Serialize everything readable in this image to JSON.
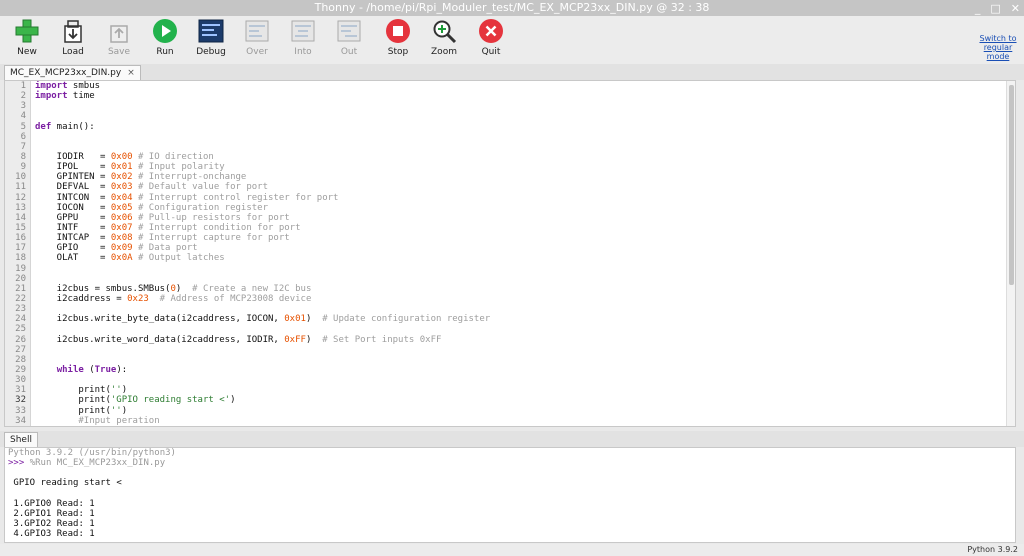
{
  "window": {
    "title": "Thonny  -  /home/pi/Rpi_Moduler_test/MC_EX_MCP23xx_DIN.py  @  32 : 38",
    "controls": [
      "_",
      "□",
      "✕"
    ]
  },
  "toolbar": {
    "buttons": [
      {
        "label": "New",
        "icon": "plus-icon",
        "enabled": true
      },
      {
        "label": "Load",
        "icon": "load-icon",
        "enabled": true
      },
      {
        "label": "Save",
        "icon": "save-icon",
        "enabled": false
      },
      {
        "label": "Run",
        "icon": "run-icon",
        "enabled": true
      },
      {
        "label": "Debug",
        "icon": "debug-icon",
        "enabled": true
      },
      {
        "label": "Over",
        "icon": "step-over-icon",
        "enabled": false
      },
      {
        "label": "Into",
        "icon": "step-into-icon",
        "enabled": false
      },
      {
        "label": "Out",
        "icon": "step-out-icon",
        "enabled": false
      },
      {
        "label": "Stop",
        "icon": "stop-icon",
        "enabled": true
      },
      {
        "label": "Zoom",
        "icon": "zoom-icon",
        "enabled": true
      },
      {
        "label": "Quit",
        "icon": "quit-icon",
        "enabled": true
      }
    ],
    "switch_mode": "Switch to regular mode"
  },
  "editor": {
    "tab_label": "MC_EX_MCP23xx_DIN.py",
    "tab_close": "×",
    "current_line": 32,
    "lines": [
      "import smbus",
      "import time",
      "",
      "",
      "def main():",
      "",
      "",
      "    IODIR   = 0x00 # IO direction",
      "    IPOL    = 0x01 # Input polarity",
      "    GPINTEN = 0x02 # Interrupt-onchange",
      "    DEFVAL  = 0x03 # Default value for port",
      "    INTCON  = 0x04 # Interrupt control register for port",
      "    IOCON   = 0x05 # Configuration register",
      "    GPPU    = 0x06 # Pull-up resistors for port",
      "    INTF    = 0x07 # Interrupt condition for port",
      "    INTCAP  = 0x08 # Interrupt capture for port",
      "    GPIO    = 0x09 # Data port",
      "    OLAT    = 0x0A # Output latches",
      "",
      "",
      "    i2cbus = smbus.SMBus(0)  # Create a new I2C bus",
      "    i2caddress = 0x23  # Address of MCP23008 device",
      "",
      "    i2cbus.write_byte_data(i2caddress, IOCON, 0x01)  # Update configuration register",
      "",
      "    i2cbus.write_word_data(i2caddress, IODIR, 0xFF)  # Set Port inputs 0xFF",
      "",
      "",
      "    while (True):",
      "",
      "        print('')",
      "        print('GPIO reading start <')",
      "        print('')",
      "        #Input peration"
    ]
  },
  "shell": {
    "tab_label": "Shell",
    "lines": [
      {
        "text": "Python 3.9.2 (/usr/bin/python3)",
        "grey": true
      },
      {
        "prompt": ">>> ",
        "text": "%Run MC_EX_MCP23xx_DIN.py",
        "grey": true
      },
      {
        "text": ""
      },
      {
        "text": " GPIO reading start <"
      },
      {
        "text": ""
      },
      {
        "text": " 1.GPIO0 Read: 1"
      },
      {
        "text": " 2.GPIO1 Read: 1"
      },
      {
        "text": " 3.GPIO2 Read: 1"
      },
      {
        "text": " 4.GPIO3 Read: 1"
      }
    ]
  },
  "status": {
    "interpreter": "Python 3.9.2"
  },
  "colors": {
    "keyword": "#7b1fa2",
    "number": "#e65100",
    "comment": "#9e9e9e",
    "string": "#2e7d32"
  }
}
